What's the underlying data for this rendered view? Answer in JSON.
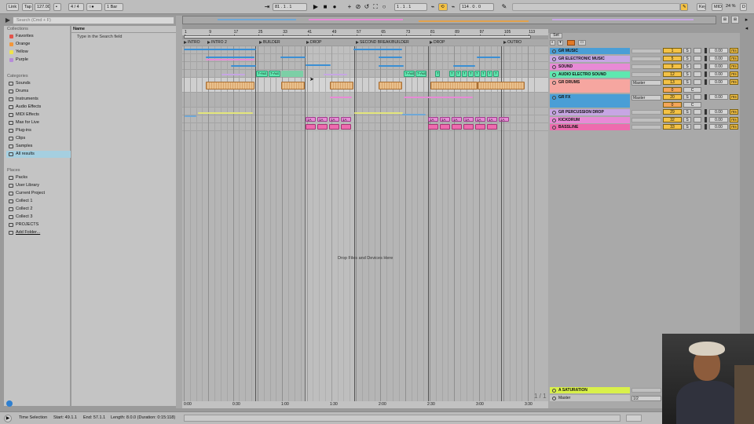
{
  "topbar": {
    "link": "Link",
    "tap": "Tap",
    "tempo": "127.00",
    "sig_num": "4",
    "sig_slash": "/",
    "sig_den": "4",
    "metronome": "○●",
    "quantize": "1 Bar",
    "position": "81 .  1 .  1",
    "loop_start": "1 .  1 .  1",
    "loop_length": "114 .  0 .  0",
    "key": "Key",
    "midi": "MIDI",
    "cpu": "24 %",
    "d": "D"
  },
  "browser": {
    "search_placeholder": "Search (Cmd + F)",
    "collections_head": "Collections",
    "collections": [
      {
        "label": "Favorites",
        "color": "#e2544b"
      },
      {
        "label": "Orange",
        "color": "#f2963a"
      },
      {
        "label": "Yellow",
        "color": "#efe34a"
      },
      {
        "label": "Purple",
        "color": "#b68bd9"
      }
    ],
    "categories_head": "Categories",
    "categories": [
      "Sounds",
      "Drums",
      "Instruments",
      "Audio Effects",
      "MIDI Effects",
      "Max for Live",
      "Plug-ins",
      "Clips",
      "Samples",
      "All results"
    ],
    "places_head": "Places",
    "places": [
      "Packs",
      "User Library",
      "Current Project",
      "Collect 1",
      "Collect 2",
      "Collect 3",
      "PROJECTS",
      "Add Folder..."
    ],
    "content_head": "Name",
    "content_hint": "Type in the Search field"
  },
  "ruler": {
    "bars": [
      "1",
      "9",
      "17",
      "25",
      "33",
      "41",
      "49",
      "57",
      "65",
      "73",
      "81",
      "89",
      "97",
      "105",
      "113"
    ]
  },
  "time_ruler": {
    "labels": [
      "0:00",
      "0:30",
      "1:00",
      "1:30",
      "2:00",
      "2:30",
      "3:00",
      "3:30"
    ]
  },
  "locators": [
    "INTRO",
    "INTRO 2",
    "BUILDER",
    "DROP",
    "SECOND BREAK/BUILDER",
    "DROP",
    "OUTRO"
  ],
  "arrangement": {
    "drop_hint": "Drop Files and Devices Here",
    "page": "1 / 1",
    "auto_clip": "7-Aut",
    "auto_clip_short": "7",
    "perc_clip": "1A"
  },
  "mixer": {
    "set_label": "Set",
    "master_label": "Master",
    "tracks": [
      {
        "name": "GR MUSIC",
        "color": "#4a9ed6",
        "num": "1"
      },
      {
        "name": "GR ELECTRONIC MUSIC",
        "color": "#c7a6e4",
        "num": "5"
      },
      {
        "name": "SOUND",
        "color": "#e88ad6",
        "num": "9"
      },
      {
        "name": "AUDIO ELECTRO SOUND",
        "color": "#5fe8b0",
        "num": "12"
      },
      {
        "name": "GR DRUMS",
        "color": "#f6a6a0",
        "num": "13",
        "route": "Master",
        "extra": "0"
      },
      {
        "name": "GR FX",
        "color": "#4a9ed6",
        "num": "20",
        "route": "Master",
        "extra": "0"
      },
      {
        "name": "GR PERCUSSION DROP",
        "color": "#c7a6e4",
        "num": "29"
      },
      {
        "name": "KICKDRUM",
        "color": "#e88ad6",
        "num": "32"
      },
      {
        "name": "BASSLINE",
        "color": "#ee6bae",
        "num": "33"
      }
    ],
    "solo": "S",
    "cue": "C",
    "volume": "0.00",
    "ms": "ms",
    "return_track": "A SATURATION",
    "return_color": "#d9f04a",
    "master_track": "Master",
    "master_route": "1/2"
  },
  "status": {
    "mode": "Time Selection",
    "start": "Start: 49.1.1",
    "end": "End: 57.1.1",
    "length": "Length: 8.0.0 (Duration: 0:15:118)"
  }
}
